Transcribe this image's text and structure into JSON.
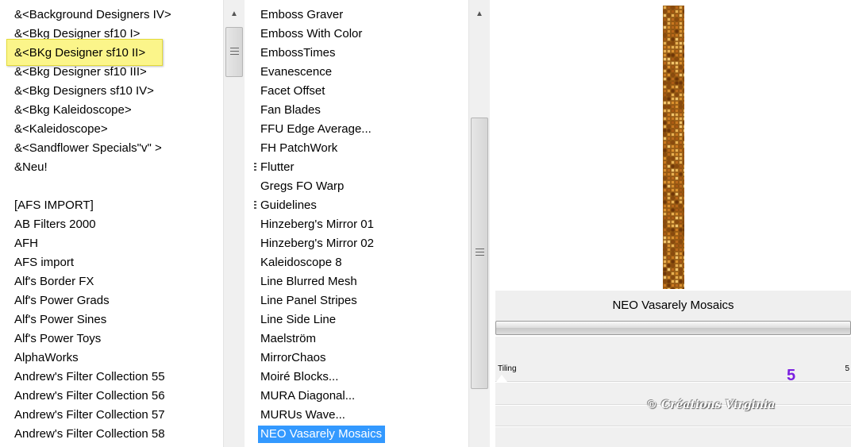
{
  "categories": {
    "items": [
      "&<Background Designers IV>",
      "&<Bkg Designer sf10 I>",
      "&<BKg Designer sf10 II>",
      "&<Bkg Designer sf10 III>",
      "&<Bkg Designers sf10 IV>",
      "&<Bkg Kaleidoscope>",
      "&<Kaleidoscope>",
      "&<Sandflower Specials\"v\" >",
      "&Neu!",
      "",
      "[AFS IMPORT]",
      "AB Filters 2000",
      "AFH",
      "AFS import",
      "Alf's Border FX",
      "Alf's Power Grads",
      "Alf's Power Sines",
      "Alf's Power Toys",
      "AlphaWorks",
      "Andrew's Filter Collection 55",
      "Andrew's Filter Collection 56",
      "Andrew's Filter Collection 57",
      "Andrew's Filter Collection 58"
    ],
    "highlighted": "&<BKg Designer sf10 II>"
  },
  "filters": {
    "items": [
      {
        "label": "Emboss Graver"
      },
      {
        "label": "Emboss With Color"
      },
      {
        "label": "EmbossTimes"
      },
      {
        "label": "Evanescence"
      },
      {
        "label": "Facet Offset"
      },
      {
        "label": "Fan Blades"
      },
      {
        "label": "FFU Edge Average..."
      },
      {
        "label": "FH PatchWork"
      },
      {
        "label": "Flutter",
        "sub": true
      },
      {
        "label": "Gregs FO Warp"
      },
      {
        "label": "Guidelines",
        "sub": true
      },
      {
        "label": "Hinzeberg's Mirror 01"
      },
      {
        "label": "Hinzeberg's Mirror 02"
      },
      {
        "label": "Kaleidoscope 8"
      },
      {
        "label": "Line Blurred Mesh"
      },
      {
        "label": "Line Panel Stripes"
      },
      {
        "label": "Line Side Line"
      },
      {
        "label": "Maelström"
      },
      {
        "label": "MirrorChaos"
      },
      {
        "label": "Moiré Blocks..."
      },
      {
        "label": "MURA Diagonal..."
      },
      {
        "label": "MURUs Wave..."
      },
      {
        "label": "NEO Vasarely Mosaics",
        "selected": true
      }
    ]
  },
  "preview": {
    "filter_name": "NEO Vasarely Mosaics",
    "param_label": "Tiling",
    "param_value": "5",
    "annotation_value": "5",
    "watermark": "© Créations Virginia",
    "strip_color": "#c27d1c"
  },
  "colors": {
    "selection": "#3399ff",
    "highlight": "#fbf58a",
    "annotation": "#7a1ee0"
  }
}
